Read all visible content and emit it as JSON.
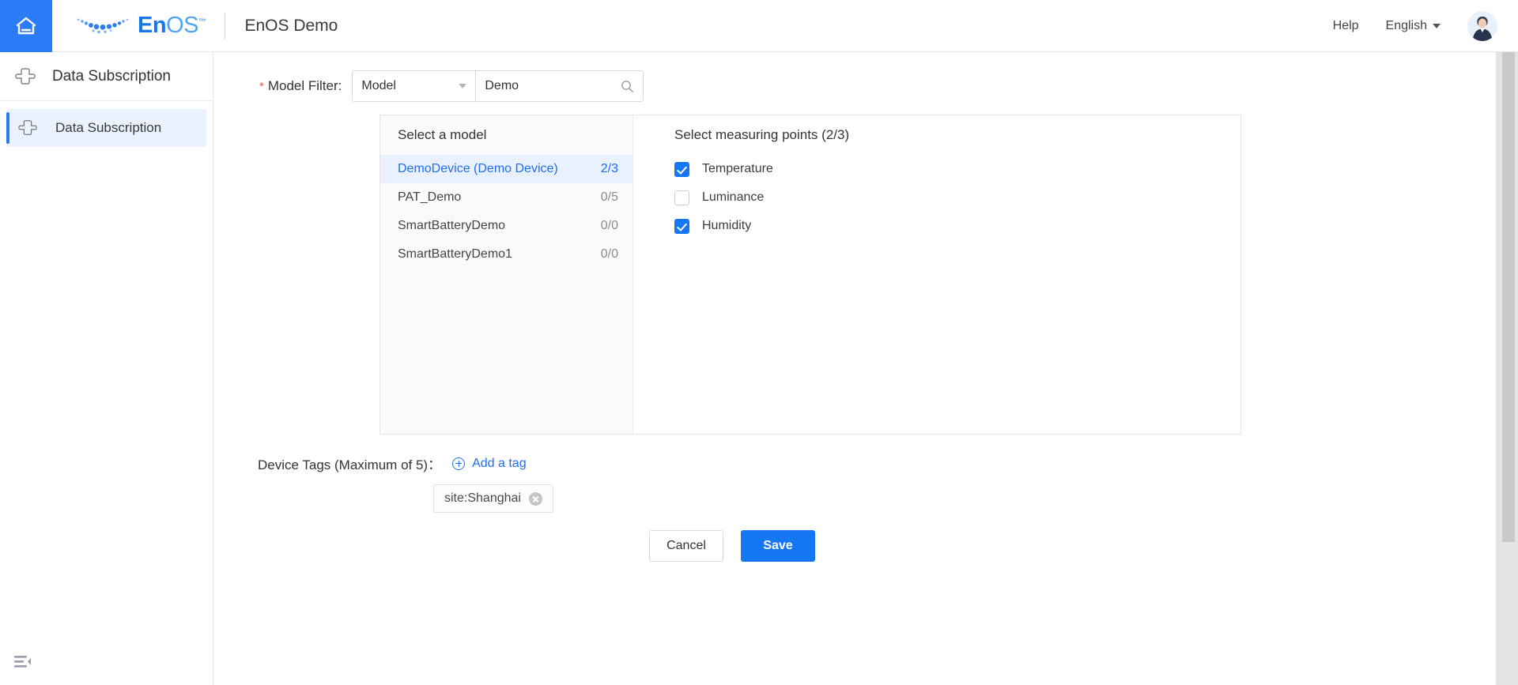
{
  "header": {
    "home_icon": "home-icon",
    "logo_en": "En",
    "logo_os": "OS",
    "logo_tm": "™",
    "app_title": "EnOS Demo",
    "help_label": "Help",
    "language_label": "English",
    "avatar_icon": "user-avatar"
  },
  "sidebar": {
    "section_title": "Data Subscription",
    "items": [
      {
        "label": "Data Subscription",
        "icon": "subscription-icon",
        "active": true
      }
    ],
    "collapse_icon": "collapse-menu-icon"
  },
  "filter": {
    "required_marker": "*",
    "label": "Model Filter:",
    "select_value": "Model",
    "select_options": [
      "Model"
    ],
    "search_value": "Demo",
    "search_placeholder": "",
    "search_icon": "search-icon"
  },
  "model_panel": {
    "header": "Select a model",
    "rows": [
      {
        "name": "DemoDevice (Demo Device)",
        "count": "2/3",
        "selected": true
      },
      {
        "name": "PAT_Demo",
        "count": "0/5",
        "selected": false
      },
      {
        "name": "SmartBatteryDemo",
        "count": "0/0",
        "selected": false
      },
      {
        "name": "SmartBatteryDemo1",
        "count": "0/0",
        "selected": false
      }
    ]
  },
  "measuring_panel": {
    "header": "Select measuring points (2/3)",
    "points": [
      {
        "label": "Temperature",
        "checked": true
      },
      {
        "label": "Luminance",
        "checked": false
      },
      {
        "label": "Humidity",
        "checked": true
      }
    ]
  },
  "tags": {
    "label": "Device Tags (Maximum of 5)：",
    "add_label": "Add a tag",
    "add_icon": "plus-circle-icon",
    "chips": [
      {
        "text": "site:Shanghai",
        "remove_icon": "remove-tag-icon"
      }
    ]
  },
  "actions": {
    "cancel_label": "Cancel",
    "save_label": "Save"
  },
  "colors": {
    "brand_blue": "#1677f5",
    "home_blue": "#2a7cf6",
    "selected_row_bg": "#e9f1fe",
    "required_red": "#f5544c"
  }
}
